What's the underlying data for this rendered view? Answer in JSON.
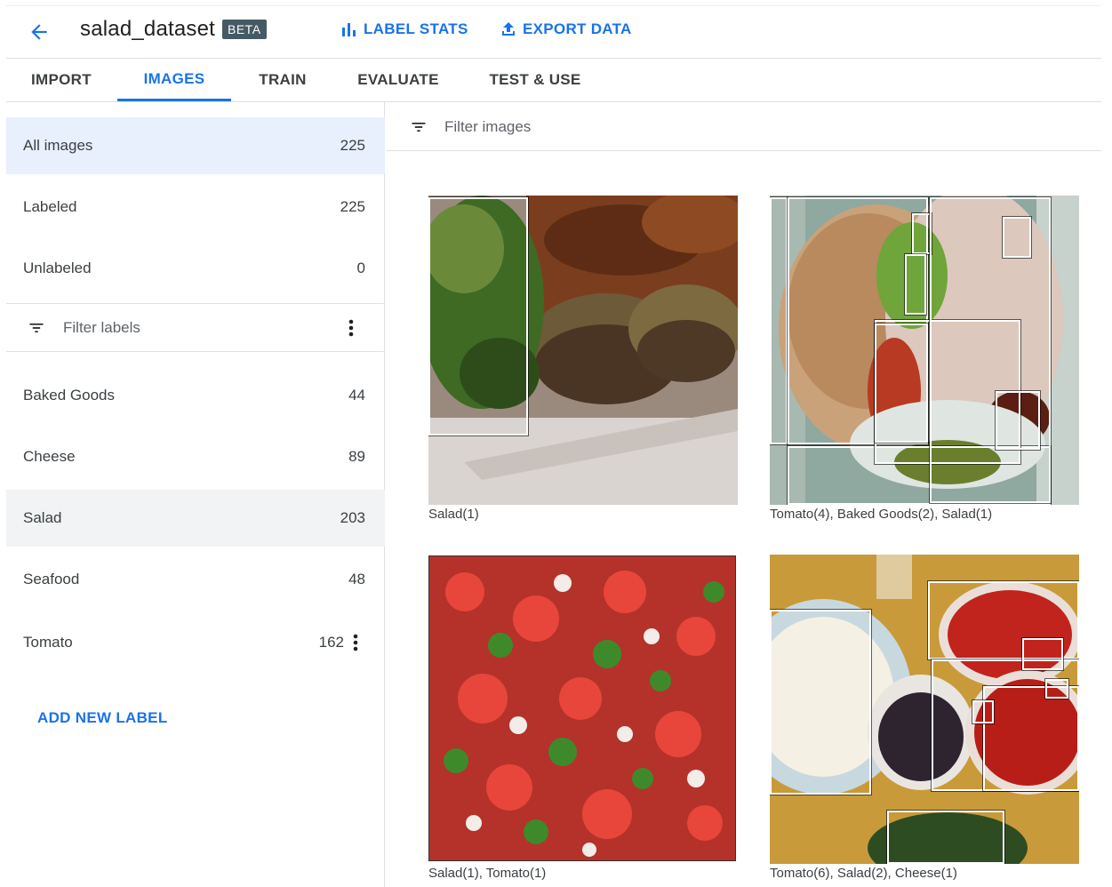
{
  "header": {
    "title": "salad_dataset",
    "badge": "BETA",
    "label_stats": "LABEL STATS",
    "export_data": "EXPORT DATA",
    "accent": "#1a73e8"
  },
  "tabs": [
    {
      "label": "IMPORT",
      "active": false
    },
    {
      "label": "IMAGES",
      "active": true
    },
    {
      "label": "TRAIN",
      "active": false
    },
    {
      "label": "EVALUATE",
      "active": false
    },
    {
      "label": "TEST & USE",
      "active": false
    }
  ],
  "sidebar": {
    "status_items": [
      {
        "label": "All images",
        "count": "225"
      },
      {
        "label": "Labeled",
        "count": "225"
      },
      {
        "label": "Unlabeled",
        "count": "0"
      }
    ],
    "filter_placeholder": "Filter labels",
    "labels": [
      {
        "label": "Baked Goods",
        "count": "44"
      },
      {
        "label": "Cheese",
        "count": "89"
      },
      {
        "label": "Salad",
        "count": "203"
      },
      {
        "label": "Seafood",
        "count": "48"
      },
      {
        "label": "Tomato",
        "count": "162"
      }
    ],
    "add_label": "ADD NEW LABEL"
  },
  "main": {
    "filter_placeholder": "Filter images",
    "images": [
      {
        "caption": "Salad(1)"
      },
      {
        "caption": "Tomato(4), Baked Goods(2), Salad(1)"
      },
      {
        "caption": "Salad(1), Tomato(1)"
      },
      {
        "caption": "Tomato(6), Salad(2), Cheese(1)"
      }
    ]
  },
  "icons": {
    "back": "arrow-back-icon",
    "stats": "bar-chart-icon",
    "export": "upload-icon",
    "filter": "filter-list-icon",
    "more": "more-vert-icon"
  }
}
